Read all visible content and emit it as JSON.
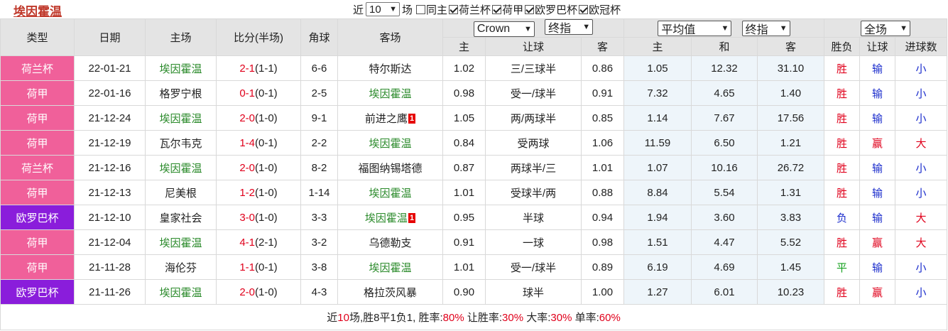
{
  "title": "埃因霍温",
  "filters": {
    "prefix": "近",
    "count_value": "10",
    "suffix": "场",
    "items": [
      {
        "label": "同主",
        "checked": false
      },
      {
        "label": "荷兰杯",
        "checked": true
      },
      {
        "label": "荷甲",
        "checked": true
      },
      {
        "label": "欧罗巴杯",
        "checked": true
      },
      {
        "label": "欧冠杯",
        "checked": true
      }
    ]
  },
  "header": {
    "type": "类型",
    "date": "日期",
    "home": "主场",
    "score": "比分(半场)",
    "corners": "角球",
    "away": "客场",
    "company_select": "Crown",
    "handicap_select": "终指",
    "avg_select": "平均值",
    "odds_select": "终指",
    "range_select": "全场",
    "sub": {
      "h_home": "主",
      "h_line": "让球",
      "h_away": "客",
      "o_home": "主",
      "o_draw": "和",
      "o_away": "客",
      "r_wl": "胜负",
      "r_hc": "让球",
      "r_goals": "进球数"
    }
  },
  "rows": [
    {
      "league": "荷兰杯",
      "league_color": "pink",
      "date": "22-01-21",
      "home": "埃因霍温",
      "home_team_highlight": true,
      "score": "2-1",
      "half": "(1-1)",
      "corners": "6-6",
      "away": "特尔斯达",
      "away_team_highlight": false,
      "red_card": "",
      "h_home": "1.02",
      "h_line": "三/三球半",
      "h_away": "0.86",
      "o_home": "1.05",
      "o_draw": "12.32",
      "o_away": "31.10",
      "wl": "胜",
      "wl_color": "red",
      "hc": "输",
      "hc_color": "blue",
      "goals": "小",
      "goals_color": "blue"
    },
    {
      "league": "荷甲",
      "league_color": "pink",
      "date": "22-01-16",
      "home": "格罗宁根",
      "home_team_highlight": false,
      "score": "0-1",
      "half": "(0-1)",
      "corners": "2-5",
      "away": "埃因霍温",
      "away_team_highlight": true,
      "red_card": "",
      "h_home": "0.98",
      "h_line": "受一/球半",
      "h_away": "0.91",
      "o_home": "7.32",
      "o_draw": "4.65",
      "o_away": "1.40",
      "wl": "胜",
      "wl_color": "red",
      "hc": "输",
      "hc_color": "blue",
      "goals": "小",
      "goals_color": "blue"
    },
    {
      "league": "荷甲",
      "league_color": "pink",
      "date": "21-12-24",
      "home": "埃因霍温",
      "home_team_highlight": true,
      "score": "2-0",
      "half": "(1-0)",
      "corners": "9-1",
      "away": "前进之鹰",
      "away_team_highlight": false,
      "red_card": "1",
      "h_home": "1.05",
      "h_line": "两/两球半",
      "h_away": "0.85",
      "o_home": "1.14",
      "o_draw": "7.67",
      "o_away": "17.56",
      "wl": "胜",
      "wl_color": "red",
      "hc": "输",
      "hc_color": "blue",
      "goals": "小",
      "goals_color": "blue"
    },
    {
      "league": "荷甲",
      "league_color": "pink",
      "date": "21-12-19",
      "home": "瓦尔韦克",
      "home_team_highlight": false,
      "score": "1-4",
      "half": "(0-1)",
      "corners": "2-2",
      "away": "埃因霍温",
      "away_team_highlight": true,
      "red_card": "",
      "h_home": "0.84",
      "h_line": "受两球",
      "h_away": "1.06",
      "o_home": "11.59",
      "o_draw": "6.50",
      "o_away": "1.21",
      "wl": "胜",
      "wl_color": "red",
      "hc": "赢",
      "hc_color": "red",
      "goals": "大",
      "goals_color": "red"
    },
    {
      "league": "荷兰杯",
      "league_color": "pink",
      "date": "21-12-16",
      "home": "埃因霍温",
      "home_team_highlight": true,
      "score": "2-0",
      "half": "(1-0)",
      "corners": "8-2",
      "away": "福图纳锡塔德",
      "away_team_highlight": false,
      "red_card": "",
      "h_home": "0.87",
      "h_line": "两球半/三",
      "h_away": "1.01",
      "o_home": "1.07",
      "o_draw": "10.16",
      "o_away": "26.72",
      "wl": "胜",
      "wl_color": "red",
      "hc": "输",
      "hc_color": "blue",
      "goals": "小",
      "goals_color": "blue"
    },
    {
      "league": "荷甲",
      "league_color": "pink",
      "date": "21-12-13",
      "home": "尼美根",
      "home_team_highlight": false,
      "score": "1-2",
      "half": "(1-0)",
      "corners": "1-14",
      "away": "埃因霍温",
      "away_team_highlight": true,
      "red_card": "",
      "h_home": "1.01",
      "h_line": "受球半/两",
      "h_away": "0.88",
      "o_home": "8.84",
      "o_draw": "5.54",
      "o_away": "1.31",
      "wl": "胜",
      "wl_color": "red",
      "hc": "输",
      "hc_color": "blue",
      "goals": "小",
      "goals_color": "blue"
    },
    {
      "league": "欧罗巴杯",
      "league_color": "purple",
      "date": "21-12-10",
      "home": "皇家社会",
      "home_team_highlight": false,
      "score": "3-0",
      "half": "(1-0)",
      "corners": "3-3",
      "away": "埃因霍温",
      "away_team_highlight": true,
      "red_card": "1",
      "h_home": "0.95",
      "h_line": "半球",
      "h_away": "0.94",
      "o_home": "1.94",
      "o_draw": "3.60",
      "o_away": "3.83",
      "wl": "负",
      "wl_color": "blue",
      "hc": "输",
      "hc_color": "blue",
      "goals": "大",
      "goals_color": "red"
    },
    {
      "league": "荷甲",
      "league_color": "pink",
      "date": "21-12-04",
      "home": "埃因霍温",
      "home_team_highlight": true,
      "score": "4-1",
      "half": "(2-1)",
      "corners": "3-2",
      "away": "乌德勒支",
      "away_team_highlight": false,
      "red_card": "",
      "h_home": "0.91",
      "h_line": "一球",
      "h_away": "0.98",
      "o_home": "1.51",
      "o_draw": "4.47",
      "o_away": "5.52",
      "wl": "胜",
      "wl_color": "red",
      "hc": "赢",
      "hc_color": "red",
      "goals": "大",
      "goals_color": "red"
    },
    {
      "league": "荷甲",
      "league_color": "pink",
      "date": "21-11-28",
      "home": "海伦芬",
      "home_team_highlight": false,
      "score": "1-1",
      "half": "(0-1)",
      "corners": "3-8",
      "away": "埃因霍温",
      "away_team_highlight": true,
      "red_card": "",
      "h_home": "1.01",
      "h_line": "受一/球半",
      "h_away": "0.89",
      "o_home": "6.19",
      "o_draw": "4.69",
      "o_away": "1.45",
      "wl": "平",
      "wl_color": "green",
      "hc": "输",
      "hc_color": "blue",
      "goals": "小",
      "goals_color": "blue"
    },
    {
      "league": "欧罗巴杯",
      "league_color": "purple",
      "date": "21-11-26",
      "home": "埃因霍温",
      "home_team_highlight": true,
      "score": "2-0",
      "half": "(1-0)",
      "corners": "4-3",
      "away": "格拉茨风暴",
      "away_team_highlight": false,
      "red_card": "",
      "h_home": "0.90",
      "h_line": "球半",
      "h_away": "1.00",
      "o_home": "1.27",
      "o_draw": "6.01",
      "o_away": "10.23",
      "wl": "胜",
      "wl_color": "red",
      "hc": "赢",
      "hc_color": "red",
      "goals": "小",
      "goals_color": "blue"
    }
  ],
  "summary": {
    "t1": "近",
    "count": "10",
    "t2": "场,胜8平1负1, 胜率:",
    "win_rate": "80%",
    "t3": " 让胜率:",
    "hc_rate": "30%",
    "t4": " 大率:",
    "big_rate": "30%",
    "t5": " 单率:",
    "odd_rate": "60%"
  },
  "colors": {
    "pink": "#f0609a",
    "purple": "#8a1ddb",
    "red": "#e0001b",
    "blue": "#1a2ccc",
    "green": "#14a01e",
    "team_green": "#2a8a2a"
  }
}
